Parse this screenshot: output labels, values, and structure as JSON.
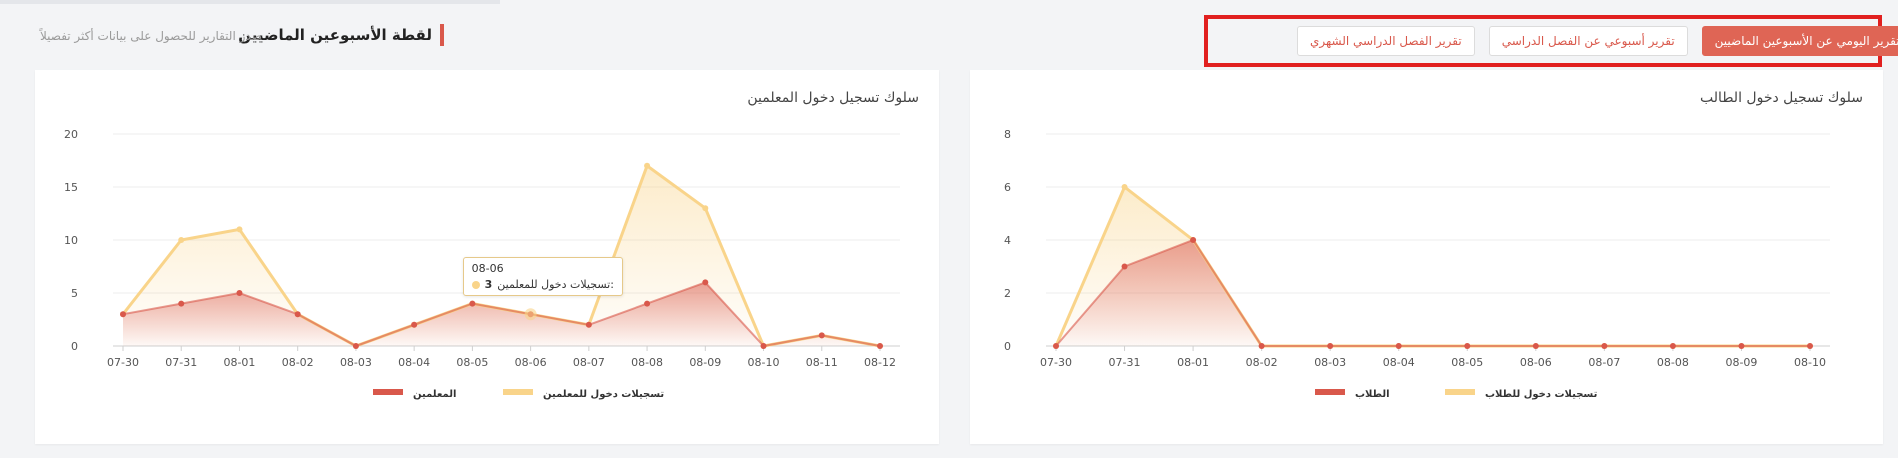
{
  "header": {
    "title": "لقطة الأسبوعين الماضيين",
    "subtitle": "صدر التقارير للحصول على بيانات أكثر تفصيلاً"
  },
  "tabs": [
    {
      "label": "التقرير اليومي عن الأسبوعين الماضيين",
      "active": true
    },
    {
      "label": "تقرير أسبوعي عن الفصل الدراسي",
      "active": false
    },
    {
      "label": "تقرير الفصل الدراسي الشهري",
      "active": false
    }
  ],
  "colors": {
    "accent": "#df6555",
    "line_light": "#f9d48a",
    "line_dark": "#d9584b",
    "highlight_border": "#e1201f"
  },
  "charts": {
    "teachers": {
      "title": "سلوك تسجيل دخول المعلمين",
      "legend": [
        "تسجيلات دخول للمعلمين",
        "المعلمين"
      ],
      "tooltip": {
        "date": "08-06",
        "label": "تسجيلات دخول للمعلمين:",
        "value": "3"
      }
    },
    "students": {
      "title": "سلوك تسجيل دخول الطالب",
      "legend": [
        "تسجيلات دخول للطلاب",
        "الطلاب"
      ]
    }
  },
  "chart_data": [
    {
      "type": "area",
      "title": "سلوك تسجيل دخول المعلمين",
      "categories": [
        "07-30",
        "07-31",
        "08-01",
        "08-02",
        "08-03",
        "08-04",
        "08-05",
        "08-06",
        "08-07",
        "08-08",
        "08-09",
        "08-10",
        "08-11",
        "08-12"
      ],
      "ylim": [
        0,
        20
      ],
      "yticks": [
        0,
        5,
        10,
        15,
        20
      ],
      "series": [
        {
          "name": "تسجيلات دخول للمعلمين",
          "color": "#f9d48a",
          "values": [
            3,
            10,
            11,
            3,
            0,
            2,
            4,
            3,
            2,
            17,
            13,
            0,
            1,
            0
          ]
        },
        {
          "name": "المعلمين",
          "color": "#d9584b",
          "values": [
            3,
            4,
            5,
            3,
            0,
            2,
            4,
            3,
            2,
            4,
            6,
            0,
            1,
            0
          ]
        }
      ],
      "legend": "bottom"
    },
    {
      "type": "area",
      "title": "سلوك تسجيل دخول الطالب",
      "categories": [
        "07-30",
        "07-31",
        "08-01",
        "08-02",
        "08-03",
        "08-04",
        "08-05",
        "08-06",
        "08-07",
        "08-08",
        "08-09",
        "08-10"
      ],
      "ylim": [
        0,
        8
      ],
      "yticks": [
        0,
        2,
        4,
        6,
        8
      ],
      "series": [
        {
          "name": "تسجيلات دخول للطلاب",
          "color": "#f9d48a",
          "values": [
            0,
            6,
            4,
            0,
            0,
            0,
            0,
            0,
            0,
            0,
            0,
            0
          ]
        },
        {
          "name": "الطلاب",
          "color": "#d9584b",
          "values": [
            0,
            3,
            4,
            0,
            0,
            0,
            0,
            0,
            0,
            0,
            0,
            0
          ]
        }
      ],
      "legend": "bottom"
    }
  ]
}
